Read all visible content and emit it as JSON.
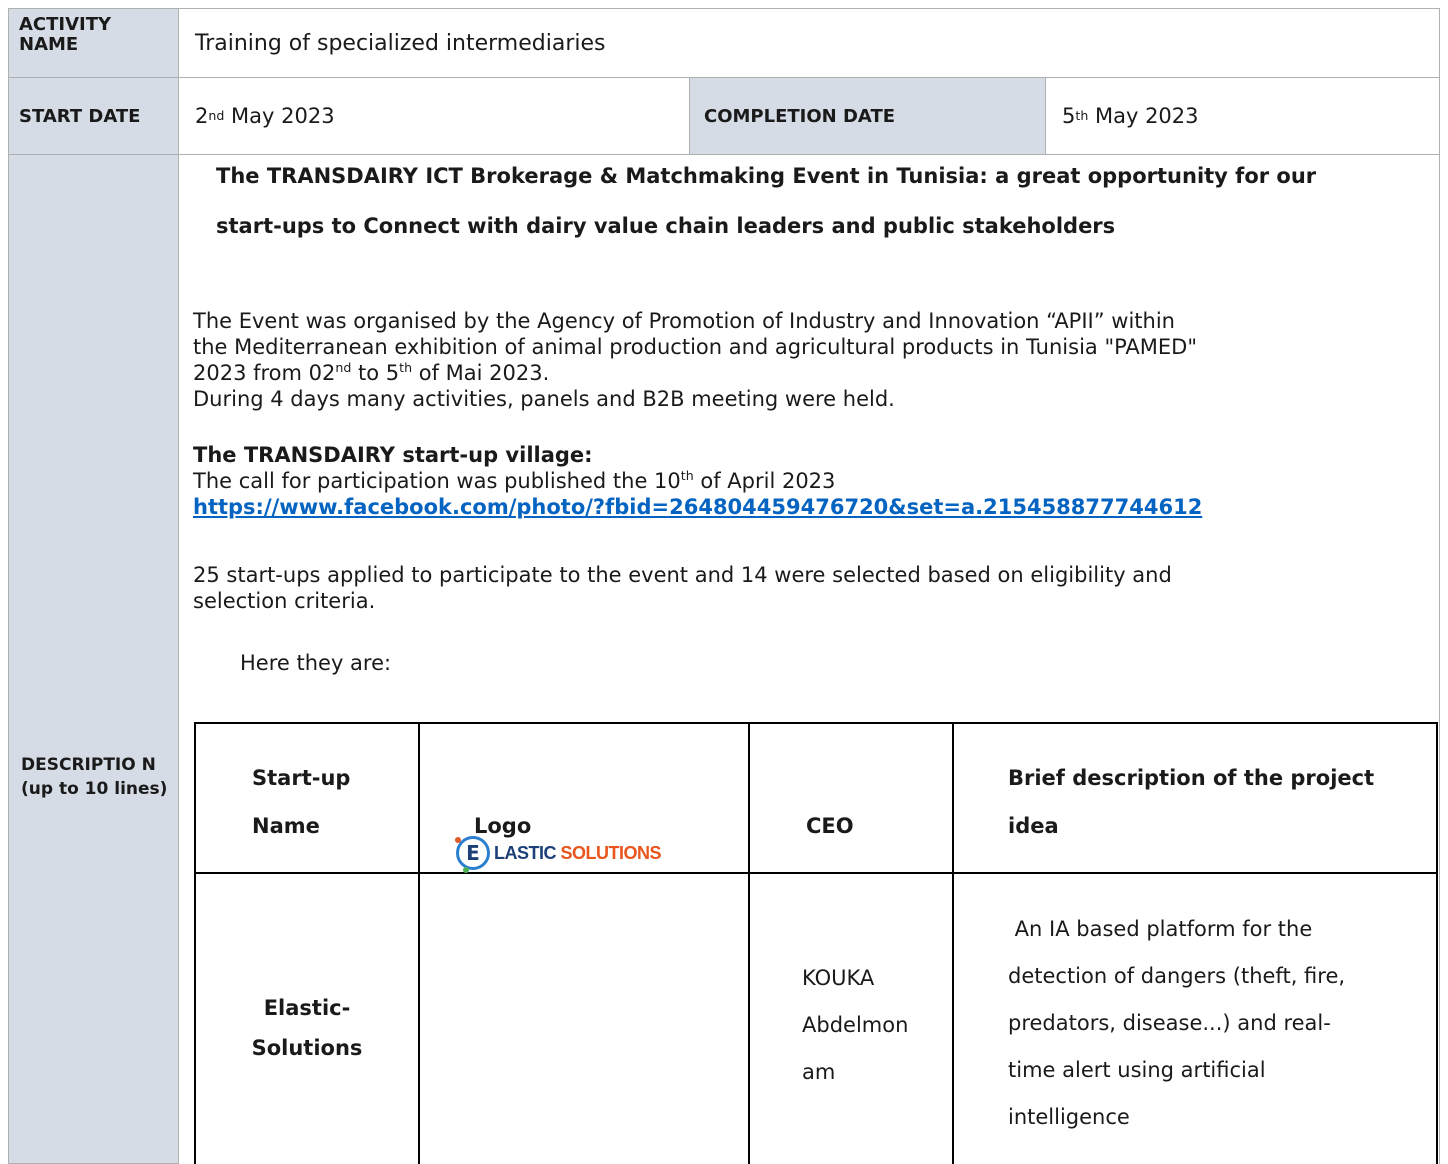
{
  "activity": {
    "name_label": "ACTIVITY NAME",
    "name_value": "Training of specialized intermediaries",
    "start_label": "START DATE",
    "start_day": "2",
    "start_sup": "nd",
    "start_rest": " May 2023",
    "completion_label": "COMPLETION DATE",
    "completion_day": "5",
    "completion_sup": "th",
    "completion_rest": " May 2023",
    "description_label": "DESCRIPTIO N (up to 10 lines)"
  },
  "description": {
    "title_line1": "The TRANSDAIRY ICT Brokerage & Matchmaking Event in Tunisia: a great opportunity for our",
    "title_line2": "start-ups to Connect with dairy value chain leaders and public stakeholders",
    "para1_line1": "The Event was organised by the Agency of Promotion of Industry and Innovation “APII” within",
    "para1_line2": "the Mediterranean exhibition of animal production and agricultural products in Tunisia \"PAMED\"",
    "para1_line3_a": "2023 from 02",
    "para1_line3_sup1": "nd",
    "para1_line3_b": " to 5",
    "para1_line3_sup2": "th",
    "para1_line3_c": " of Mai 2023.",
    "para1_line4": "During 4 days many activities, panels and B2B meeting were held.",
    "village_heading": "The TRANSDAIRY start-up village:",
    "call_a": "The call for participation was published the 10",
    "call_sup": "th",
    "call_b": " of April 2023",
    "link": "https://www.facebook.com/photo/?fbid=264804459476720&set=a.215458877744612",
    "para2_line1": "25 start-ups applied to participate to the event and 14 were selected based on eligibility and",
    "para2_line2": "selection criteria.",
    "here": "Here they are:"
  },
  "startups_table": {
    "headers": {
      "name_line1": "Start-up",
      "name_line2": "Name",
      "logo": "Logo",
      "ceo": "CEO",
      "desc_line1": "Brief description of the project",
      "desc_line2": "idea"
    },
    "rows": [
      {
        "name_line1": "Elastic-",
        "name_line2": "Solutions",
        "logo_letter": "E",
        "logo_text_a": "LASTIC ",
        "logo_text_b": "SOLUTIONS",
        "ceo_line1": "KOUKA",
        "ceo_line2": "Abdelmon",
        "ceo_line3": "am",
        "desc_line1": " An IA based platform for the",
        "desc_line2": "detection of dangers (theft, fire,",
        "desc_line3": "predators, disease...) and real-",
        "desc_line4": "time alert using artificial",
        "desc_line5": "intelligence"
      }
    ]
  },
  "colors": {
    "header_bg": "#d6dce5",
    "link": "#0563c1",
    "logo_blue": "#1d3f77",
    "logo_orange": "#e8551e"
  }
}
